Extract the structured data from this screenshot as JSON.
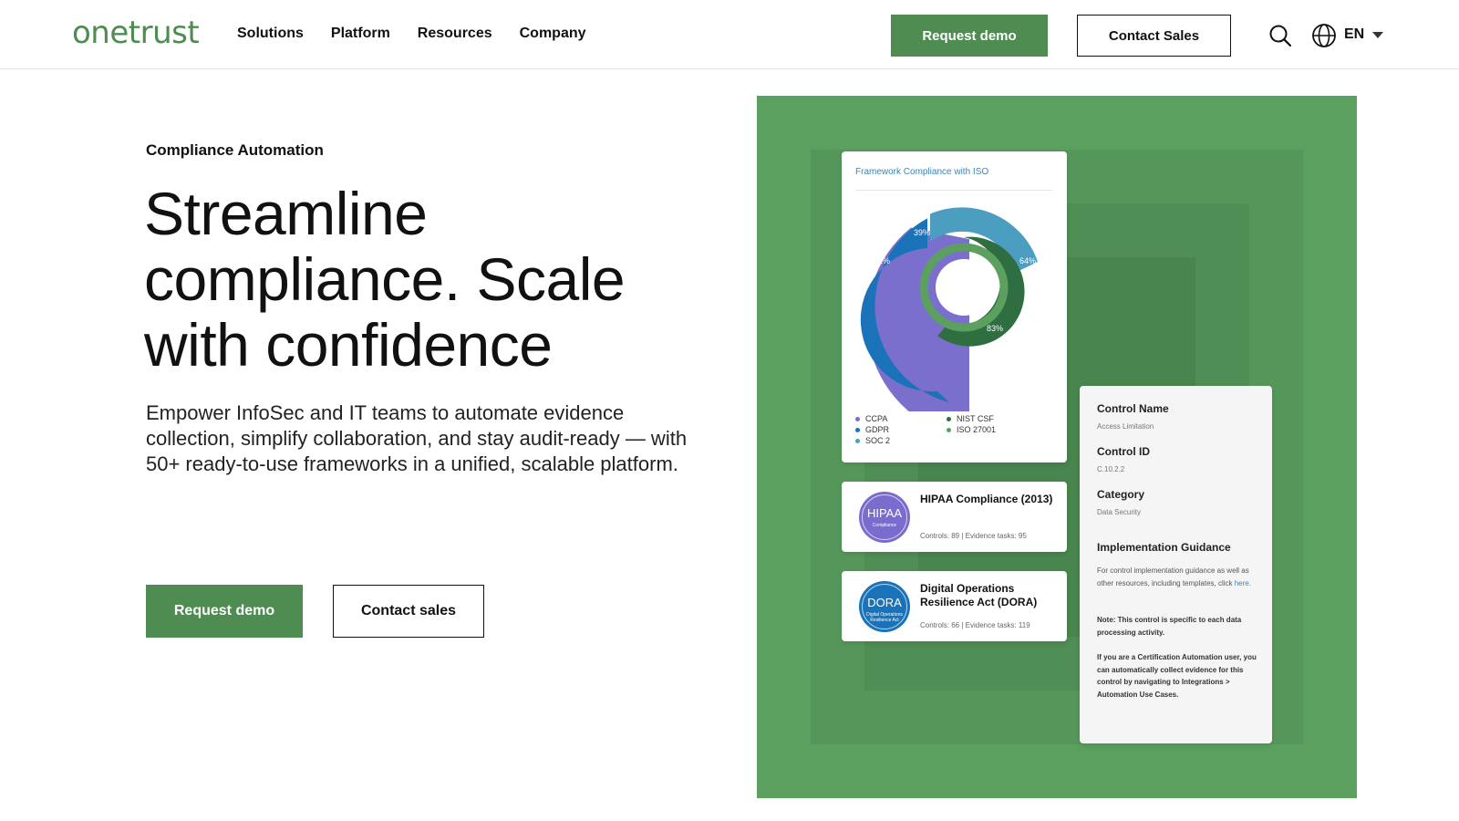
{
  "header": {
    "logo": "onetrust",
    "nav": [
      "Solutions",
      "Platform",
      "Resources",
      "Company"
    ],
    "request_demo": "Request demo",
    "contact_sales": "Contact Sales",
    "language": "EN"
  },
  "hero": {
    "eyebrow": "Compliance Automation",
    "headline": "Streamline compliance. Scale with confidence",
    "subtext": "Empower InfoSec and IT teams to automate evidence collection, simplify collaboration, and stay audit-ready — with 50+ ready-to-use frameworks in a unified, scalable platform.",
    "cta_demo": "Request demo",
    "cta_contact": "Contact sales"
  },
  "visual": {
    "chart_card": {
      "title": "Framework Compliance with ISO",
      "segments": [
        {
          "label": "32%",
          "color": "#7b6fcd"
        },
        {
          "label": "39%",
          "color": "#1a73b8"
        },
        {
          "label": "64%",
          "color": "#4b9ec0"
        },
        {
          "label": "83%",
          "color": "#2f6e40"
        }
      ],
      "legend": [
        {
          "label": "CCPA",
          "color": "#7b6fcd"
        },
        {
          "label": "NIST CSF",
          "color": "#2f6e40"
        },
        {
          "label": "GDPR",
          "color": "#1a73b8"
        },
        {
          "label": "ISO 27001",
          "color": "#5ba05e"
        },
        {
          "label": "SOC 2",
          "color": "#4b9ec0"
        }
      ]
    },
    "hipaa": {
      "badge": "HIPAA",
      "badge_sub": "Compliance",
      "title": "HIPAA Compliance (2013)",
      "meta": "Controls: 89 | Evidence tasks: 95"
    },
    "dora": {
      "badge": "DORA",
      "badge_sub": "Digital Operations Resilience Act",
      "title": "Digital Operations Resilience Act (DORA)",
      "meta": "Controls: 66 | Evidence tasks: 119"
    },
    "detail": {
      "control_name_label": "Control Name",
      "control_name_value": "Access Limitation",
      "control_id_label": "Control ID",
      "control_id_value": "C.10.2.2",
      "category_label": "Category",
      "category_value": "Data Security",
      "guidance_label": "Implementation Guidance",
      "guidance_text": "For control implementation guidance as well as other resources, including templates, click ",
      "guidance_link": "here.",
      "note": "Note: This control is specific to each data processing activity.",
      "automation_note": "If you are a Certification Automation user, you can automatically collect evidence for this control by navigating to Integrations > Automation Use Cases."
    }
  }
}
